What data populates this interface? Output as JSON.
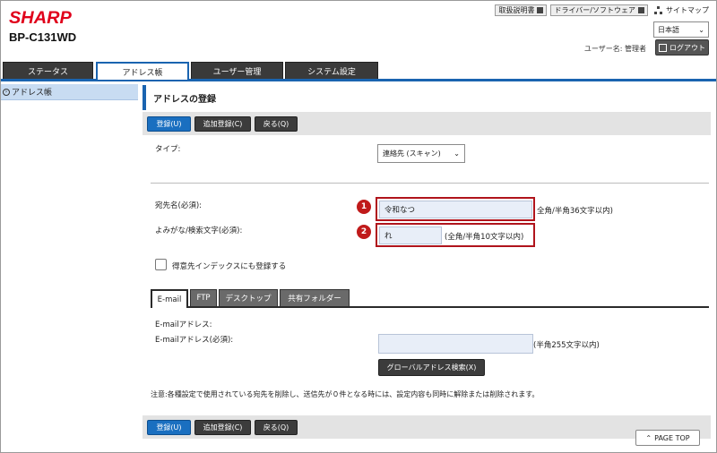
{
  "header": {
    "logo": "SHARP",
    "model": "BP-C131WD",
    "manual_label": "取扱説明書",
    "driver_label": "ドライバー/ソフトウェア",
    "sitemap_label": "サイトマップ",
    "language": "日本語",
    "user_line": "ユーザー名: 管理者",
    "logout_label": "ログアウト"
  },
  "tabs": [
    "ステータス",
    "アドレス帳",
    "ユーザー管理",
    "システム設定"
  ],
  "sidebar": {
    "items": [
      {
        "label": "アドレス帳"
      }
    ]
  },
  "main": {
    "title": "アドレスの登録",
    "buttons": {
      "register": "登録(U)",
      "add_register": "追加登録(C)",
      "back": "戻る(Q)"
    },
    "type_label": "タイプ:",
    "type_value": "連絡先 (スキャン)",
    "name_label": "宛先名(必須):",
    "name_value": "令和なつ",
    "name_hint": "全角/半角36文字以内)",
    "yomi_label": "よみがな/検索文字(必須):",
    "yomi_value": "れ",
    "yomi_hint": "(全角/半角10文字以内)",
    "index_label": "得意先インデックスにも登録する",
    "badges": [
      "1",
      "2"
    ],
    "subtabs": [
      "E-mail",
      "FTP",
      "デスクトップ",
      "共有フォルダー"
    ],
    "email_section_label": "E-mailアドレス:",
    "email_label": "E-mailアドレス(必須):",
    "email_value": "",
    "email_hint": "(半角255文字以内)",
    "global_search_label": "グローバルアドレス検索(X)",
    "note": "注意:各種設定で使用されている宛先を削除し、送信先が０件となる時には、設定内容も同時に解除または削除されます。"
  },
  "page_top_label": "PAGE TOP",
  "colors": {
    "brand": "#e0001b",
    "accent": "#1a64b0",
    "callout": "#b0141c"
  }
}
